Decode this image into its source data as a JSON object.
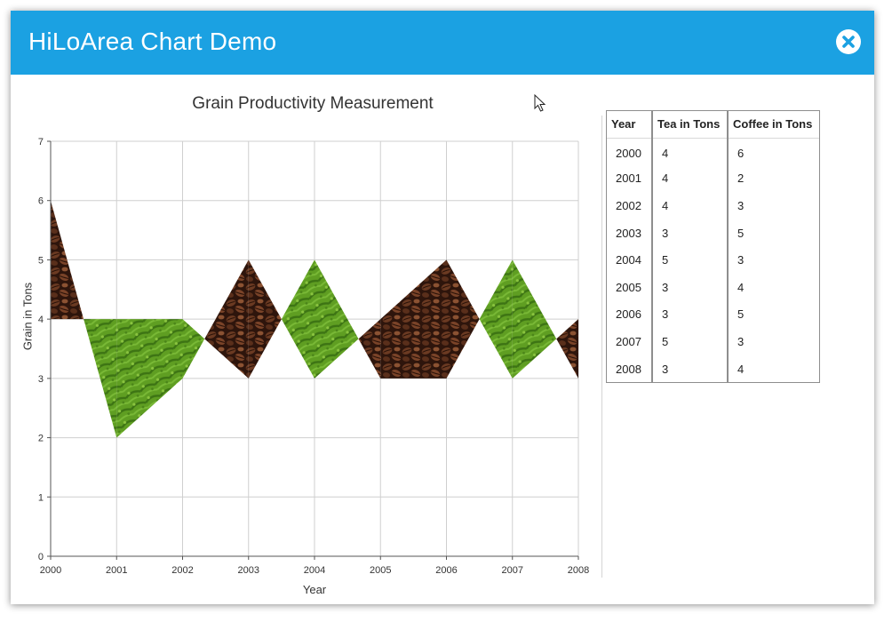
{
  "window": {
    "title": "HiLoArea Chart Demo"
  },
  "colors": {
    "titlebar": "#1ba1e2",
    "grid": "#cfcfcf",
    "tea_fill": "#5a9a1e",
    "coffee_fill": "#5a2e1c"
  },
  "icons": {
    "close": "close-circle-icon",
    "cursor": "mouse-pointer-icon"
  },
  "table": {
    "headers": [
      "Year",
      "Tea in Tons",
      "Coffee in Tons"
    ],
    "rows": [
      [
        "2000",
        "4",
        "6"
      ],
      [
        "2001",
        "4",
        "2"
      ],
      [
        "2002",
        "4",
        "3"
      ],
      [
        "2003",
        "3",
        "5"
      ],
      [
        "2004",
        "5",
        "3"
      ],
      [
        "2005",
        "3",
        "4"
      ],
      [
        "2006",
        "3",
        "5"
      ],
      [
        "2007",
        "5",
        "3"
      ],
      [
        "2008",
        "3",
        "4"
      ]
    ]
  },
  "chart_data": {
    "type": "area",
    "title": "Grain Productivity Measurement",
    "xlabel": "Year",
    "ylabel": "Grain in Tons",
    "x": [
      2000,
      2001,
      2002,
      2003,
      2004,
      2005,
      2006,
      2007,
      2008
    ],
    "ylim": [
      0,
      7
    ],
    "yticks": [
      "0",
      "1",
      "2",
      "3",
      "4",
      "5",
      "6",
      "7"
    ],
    "xticks": [
      "2000",
      "2001",
      "2002",
      "2003",
      "2004",
      "2005",
      "2006",
      "2007",
      "2008"
    ],
    "grid": true,
    "series": [
      {
        "name": "Tea in Tons",
        "values": [
          4,
          4,
          4,
          3,
          5,
          3,
          3,
          5,
          3
        ]
      },
      {
        "name": "Coffee in Tons",
        "values": [
          6,
          2,
          3,
          5,
          3,
          4,
          5,
          3,
          4
        ]
      }
    ]
  }
}
